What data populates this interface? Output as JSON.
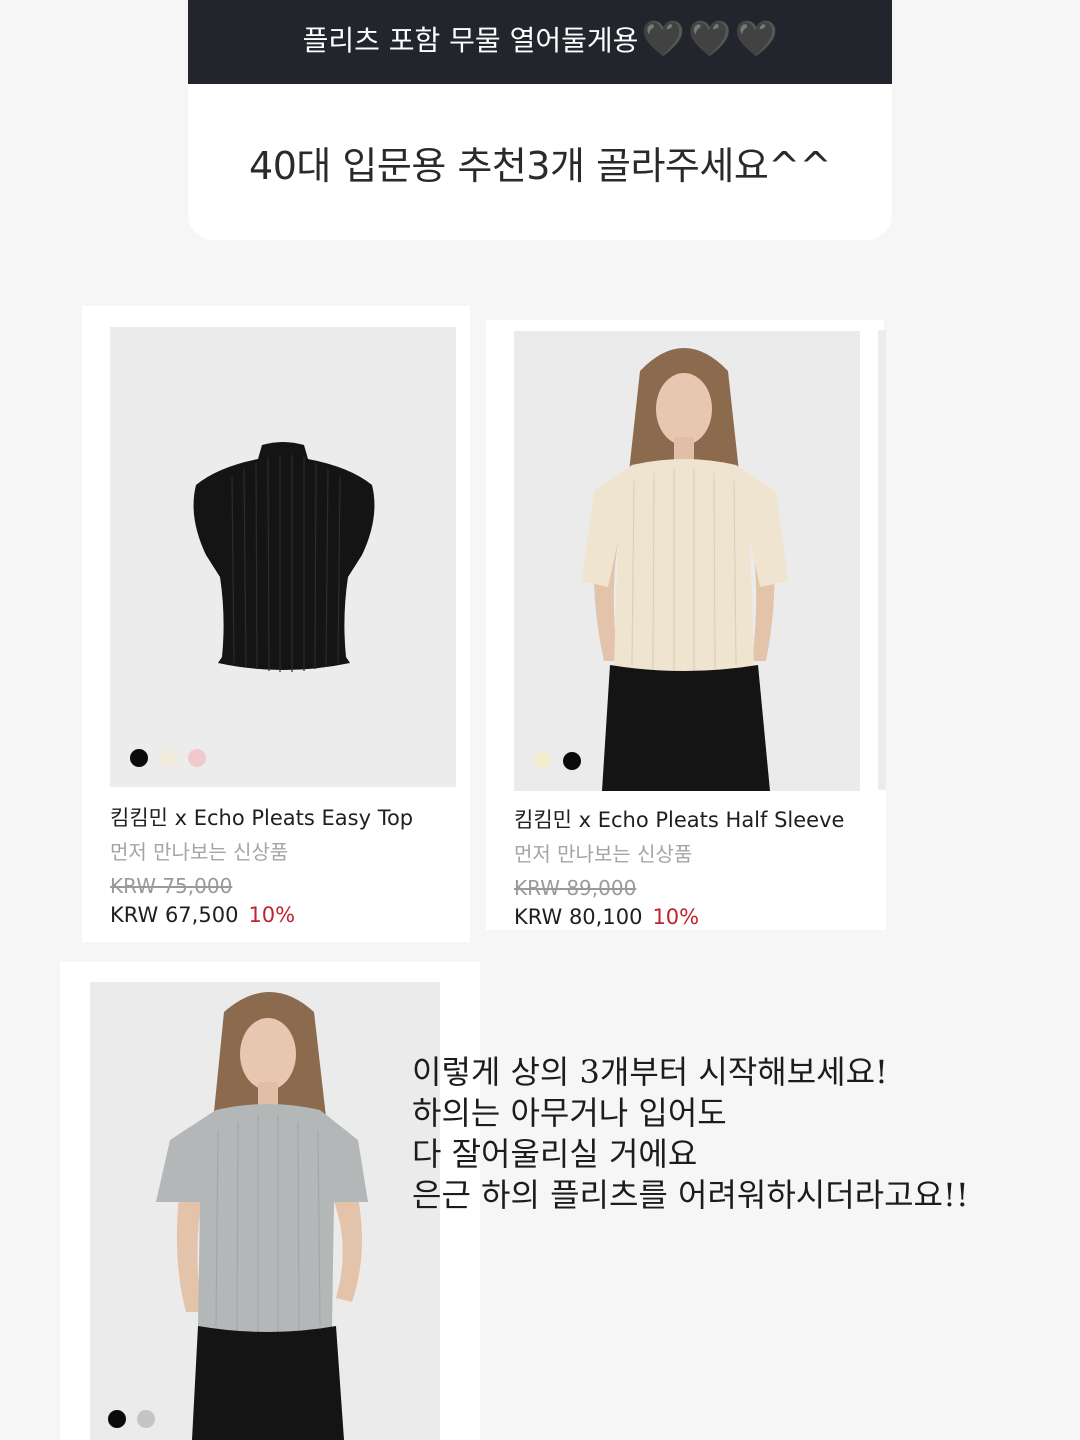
{
  "question": {
    "header_text": "플리츠 포함 무물 열어둘게용",
    "hearts": [
      "🖤",
      "🖤",
      "🖤"
    ],
    "body_text": "40대 입문용 추천3개 골라주세요^^"
  },
  "products": [
    {
      "name": "킴킴민 x Echo Pleats Easy Top",
      "subtitle": "먼저 만나보는 신상품",
      "original_price": "KRW 75,000",
      "sale_price": "KRW 67,500",
      "discount": "10%",
      "swatches": [
        "#0b0b0b",
        "#f1ecdc",
        "#efc9cb"
      ]
    },
    {
      "name": "킴킴민 x Echo Pleats Half Sleeve",
      "subtitle": "먼저 만나보는 신상품",
      "original_price": "KRW 89,000",
      "sale_price": "KRW 80,100",
      "discount": "10%",
      "swatches": [
        "#f3ecd0",
        "#0b0b0b"
      ]
    },
    {
      "swatches": [
        "#0b0b0b",
        "#c4c4c4"
      ]
    }
  ],
  "caption": {
    "lines": [
      "이렇게 상의 3개부터 시작해보세요!",
      "하의는 아무거나 입어도",
      "다 잘어울리실 거에요",
      "은근 하의 플리츠를 어려워하시더라고요!!"
    ]
  },
  "colors": {
    "header_bg": "#22262c",
    "discount": "#c0232c",
    "muted_text": "#a5a5a5"
  }
}
